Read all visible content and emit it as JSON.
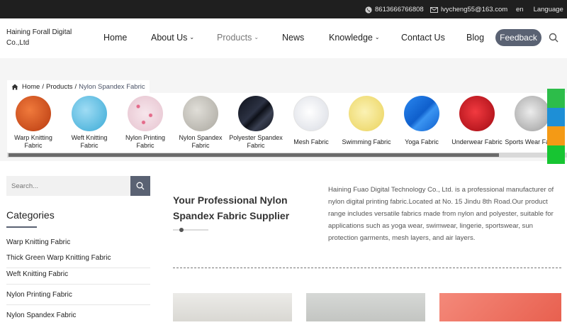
{
  "topbar": {
    "phone": "8613666766808",
    "email": "lvycheng55@163.com",
    "lang_code": "en",
    "language_label": "Language"
  },
  "header": {
    "logo_line1": "Haining Forall Digital",
    "logo_line2": "Co.,Ltd",
    "nav": {
      "home": "Home",
      "about": "About Us",
      "products": "Products",
      "news": "News",
      "knowledge": "Knowledge",
      "contact": "Contact Us",
      "blog": "Blog"
    },
    "feedback": "Feedback"
  },
  "breadcrumb": {
    "home": "Home",
    "sep1": "/",
    "products": "Products",
    "sep2": "/",
    "current": "Nylon Spandex Fabric"
  },
  "categories_strip": [
    {
      "label": "Warp Knitting Fabric",
      "color": "#d9531e"
    },
    {
      "label": "Weft Knitting Fabric",
      "color": "#6cc6ea"
    },
    {
      "label": "Nylon Printing Fabric",
      "color": "#f3d8e0"
    },
    {
      "label": "Nylon Spandex Fabric",
      "color": "#c9c7c0"
    },
    {
      "label": "Polyester Spandex Fabric",
      "color": "#1e2230"
    },
    {
      "label": "Mesh Fabric",
      "color": "#eef0f4"
    },
    {
      "label": "Swimming Fabric",
      "color": "#f6ea8c"
    },
    {
      "label": "Yoga Fabric",
      "color": "#1d74e0"
    },
    {
      "label": "Underwear Fabric",
      "color": "#d3121d"
    },
    {
      "label": "Sports Wear Fabric",
      "color": "#cfcfcf"
    }
  ],
  "side_tabs": [
    "#2dbd4a",
    "#1e8fd6",
    "#f49a15",
    "#17c532"
  ],
  "sidebar": {
    "search_placeholder": "Search...",
    "title": "Categories",
    "links": [
      "Warp Knitting Fabric",
      "Thick Green Warp Knitting Fabric",
      "Weft Knitting Fabric",
      "Nylon Printing Fabric",
      "Nylon Spandex Fabric"
    ]
  },
  "main": {
    "headline": "Your Professional Nylon Spandex Fabric Supplier",
    "paragraph": "Haining Fuao Digital Technology Co., Ltd. is a professional manufacturer of nylon digital printing fabric.Located at No. 15 Jindu 8th Road.Our product range includes versatile fabrics made from nylon and polyester, suitable for applications such as yoga wear, swimwear, lingerie, sportswear, sun protection garments, mesh layers, and air layers.",
    "products": [
      "#e4e4e1",
      "#cfd1cf",
      "#f07a68"
    ]
  },
  "colors": {
    "accent": "#5a6273",
    "topbar_bg": "#1f1f1f"
  }
}
